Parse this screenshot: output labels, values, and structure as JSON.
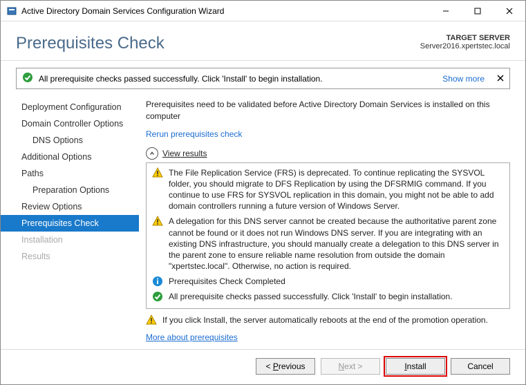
{
  "window": {
    "title": "Active Directory Domain Services Configuration Wizard"
  },
  "header": {
    "heading": "Prerequisites Check",
    "target_label": "TARGET SERVER",
    "target_value": "Server2016.xpertstec.local"
  },
  "banner": {
    "message": "All prerequisite checks passed successfully.  Click 'Install' to begin installation.",
    "show_more": "Show more"
  },
  "sidebar": {
    "items": [
      {
        "label": "Deployment Configuration"
      },
      {
        "label": "Domain Controller Options"
      },
      {
        "label": "DNS Options"
      },
      {
        "label": "Additional Options"
      },
      {
        "label": "Paths"
      },
      {
        "label": "Preparation Options"
      },
      {
        "label": "Review Options"
      },
      {
        "label": "Prerequisites Check"
      },
      {
        "label": "Installation"
      },
      {
        "label": "Results"
      }
    ]
  },
  "main": {
    "intro": "Prerequisites need to be validated before Active Directory Domain Services is installed on this computer",
    "rerun": "Rerun prerequisites check",
    "view_results": "View results",
    "results": [
      {
        "type": "warn",
        "text": "The File Replication Service (FRS) is deprecated. To continue replicating the SYSVOL folder, you should migrate to DFS Replication by using the DFSRMIG command.  If you continue to use FRS for SYSVOL replication in this domain, you might not be able to add domain controllers running a future version of Windows Server."
      },
      {
        "type": "warn",
        "text": "A delegation for this DNS server cannot be created because the authoritative parent zone cannot be found or it does not run Windows DNS server. If you are integrating with an existing DNS infrastructure, you should manually create a delegation to this DNS server in the parent zone to ensure reliable name resolution from outside the domain \"xpertstec.local\". Otherwise, no action is required."
      },
      {
        "type": "info",
        "text": "Prerequisites Check Completed"
      },
      {
        "type": "ok",
        "text": "All prerequisite checks passed successfully.  Click 'Install' to begin installation."
      }
    ],
    "footer_warning": "If you click Install, the server automatically reboots at the end of the promotion operation.",
    "more_link": "More about prerequisites"
  },
  "footer": {
    "previous": "< Previous",
    "next": "Next >",
    "install": "Install",
    "cancel": "Cancel"
  }
}
